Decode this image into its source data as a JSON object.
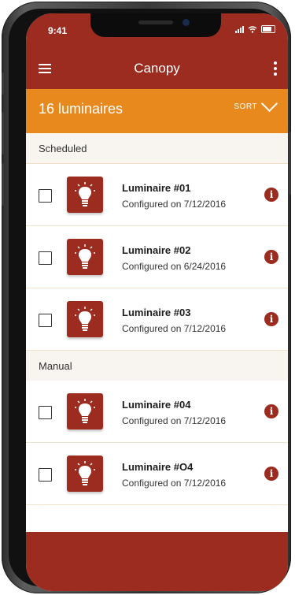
{
  "status": {
    "time": "9:41"
  },
  "app": {
    "title": "Canopy"
  },
  "count": {
    "label": "16 luminaires",
    "sort_label": "SORT"
  },
  "sections": [
    {
      "title": "Scheduled",
      "items": [
        {
          "name": "Luminaire #01",
          "configured": "Configured on 7/12/2016"
        },
        {
          "name": "Luminaire #02",
          "configured": "Configured on 6/24/2016"
        },
        {
          "name": "Luminaire #03",
          "configured": "Configured on 7/12/2016"
        }
      ]
    },
    {
      "title": "Manual",
      "items": [
        {
          "name": "Luminaire #04",
          "configured": "Configured on 7/12/2016"
        },
        {
          "name": "Luminaire #O4",
          "configured": "Configured on 7/12/2016"
        }
      ]
    }
  ],
  "colors": {
    "primary": "#9b2c1f",
    "accent": "#e8891d",
    "section_bg": "#f8f4ef"
  },
  "icons": [
    "menu-icon",
    "more-icon",
    "chevron-down-icon",
    "lightbulb-icon",
    "info-icon"
  ]
}
